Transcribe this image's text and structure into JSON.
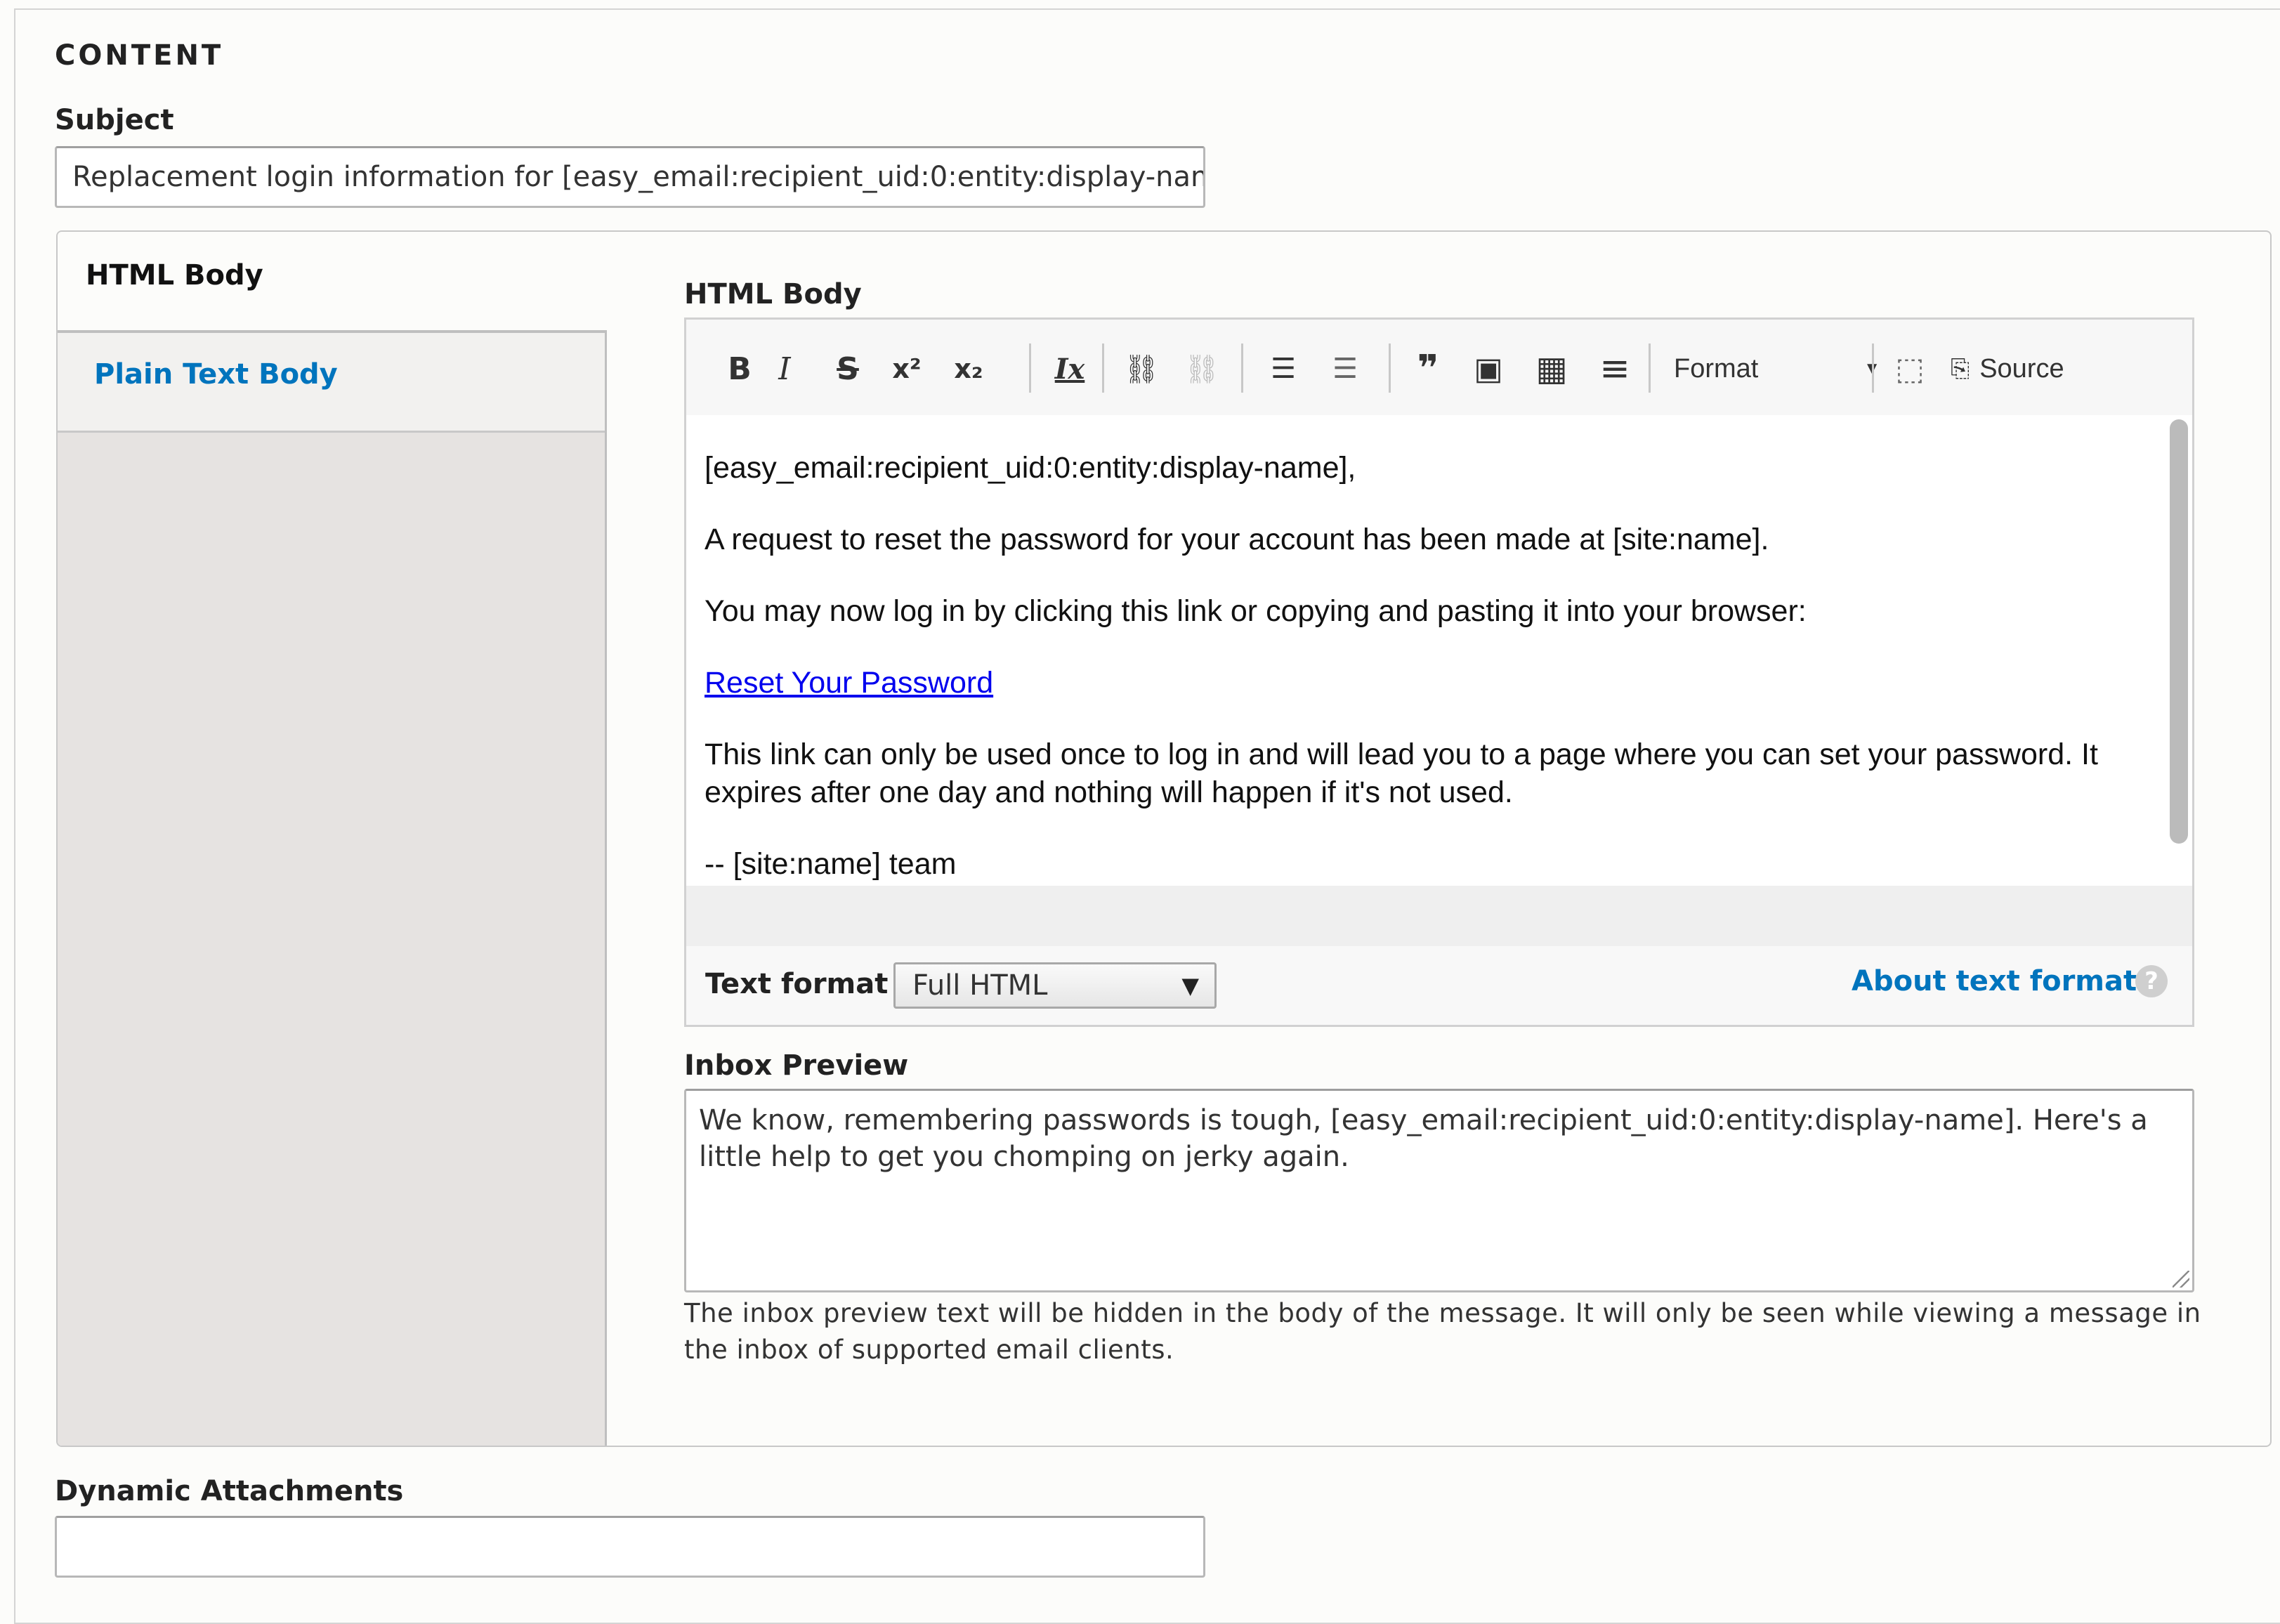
{
  "fieldset": {
    "legend": "CONTENT"
  },
  "subject": {
    "label": "Subject",
    "value": "Replacement login information for [easy_email:recipient_uid:0:entity:display-name] at [site:name]"
  },
  "vertical_tabs": {
    "items": [
      {
        "label": "HTML Body",
        "active": true
      },
      {
        "label": "Plain Text Body",
        "active": false
      }
    ]
  },
  "html_body": {
    "label": "HTML Body",
    "toolbar": {
      "buttons": [
        {
          "name": "bold",
          "glyph": "B"
        },
        {
          "name": "italic",
          "glyph": "I"
        },
        {
          "name": "strikethrough",
          "glyph": "S"
        },
        {
          "name": "superscript",
          "glyph": "x²"
        },
        {
          "name": "subscript",
          "glyph": "x₂"
        },
        {
          "name": "remove-format",
          "glyph": "Ix"
        },
        {
          "name": "link",
          "glyph": "⛓"
        },
        {
          "name": "unlink",
          "glyph": "⛓"
        },
        {
          "name": "bulleted-list",
          "glyph": "☰"
        },
        {
          "name": "numbered-list",
          "glyph": "☰"
        },
        {
          "name": "blockquote",
          "glyph": "❞"
        },
        {
          "name": "image",
          "glyph": "▣"
        },
        {
          "name": "table",
          "glyph": "▦"
        },
        {
          "name": "horizontal-line",
          "glyph": "≡"
        }
      ],
      "format_label": "Format",
      "source_label": "Source"
    },
    "content": {
      "greeting": "[easy_email:recipient_uid:0:entity:display-name],",
      "para1": "A request to reset the password for your account has been made at [site:name].",
      "para2": "You may now log in by clicking this link or copying and pasting it into your browser:",
      "link_text": "Reset Your Password",
      "para3": "This link can only be used once to log in and will lead you to a page where you can set your password. It expires after one day and nothing will happen if it's not used.",
      "signoff": "--  [site:name] team"
    },
    "text_format": {
      "label": "Text format",
      "selected": "Full HTML",
      "about_link": "About text formats",
      "help_glyph": "?"
    }
  },
  "inbox_preview": {
    "label": "Inbox Preview",
    "value": "We know, remembering passwords is tough, [easy_email:recipient_uid:0:entity:display-name]. Here's a little help to get you chomping on jerky again.",
    "description": "The inbox preview text will be hidden in the body of the message. It will only be seen while viewing a message in the inbox of supported email clients."
  },
  "dynamic_attachments": {
    "label": "Dynamic Attachments",
    "value": ""
  }
}
